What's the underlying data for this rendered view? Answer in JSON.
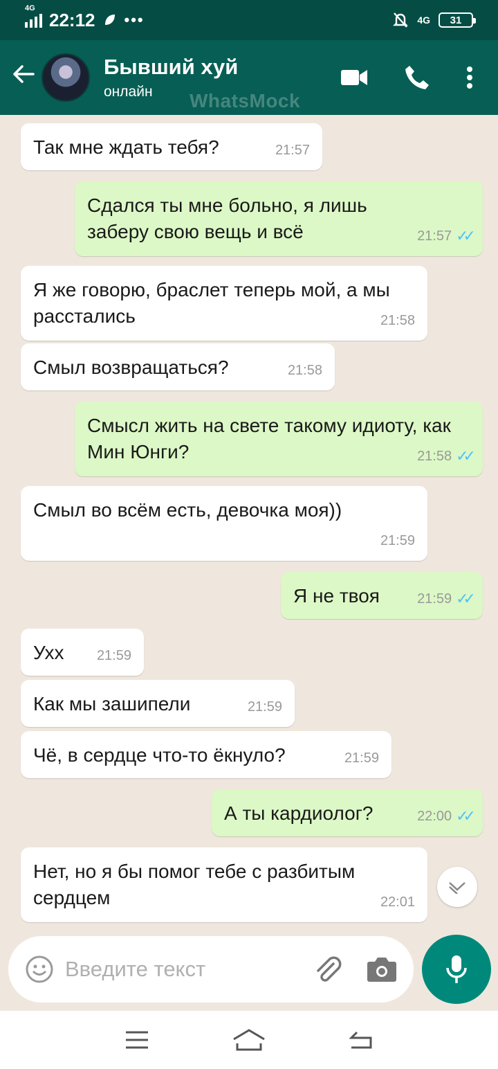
{
  "status_bar": {
    "network": "4G",
    "time": "22:12",
    "right_network": "4G",
    "battery": "31"
  },
  "header": {
    "contact_name": "Бывший хуй",
    "contact_status": "онлайн",
    "watermark": "WhatsMock"
  },
  "messages": [
    {
      "dir": "in",
      "text": "Так мне ждать тебя?",
      "time": "21:57"
    },
    {
      "dir": "out",
      "text": "Сдался ты мне больно, я лишь заберу свою вещь и всё",
      "time": "21:57"
    },
    {
      "dir": "in",
      "text": "Я же говорю, браслет теперь мой, а мы расстались",
      "time": "21:58"
    },
    {
      "dir": "in",
      "text": "Смыл возвращаться?",
      "time": "21:58"
    },
    {
      "dir": "out",
      "text": "Смысл жить на свете такому идиоту, как Мин Юнги?",
      "time": "21:58"
    },
    {
      "dir": "in",
      "text": "Смыл во всём есть, девочка моя))",
      "time": "21:59"
    },
    {
      "dir": "out",
      "text": "Я не твоя",
      "time": "21:59"
    },
    {
      "dir": "in",
      "text": "Ухх",
      "time": "21:59"
    },
    {
      "dir": "in",
      "text": "Как мы зашипели",
      "time": "21:59"
    },
    {
      "dir": "in",
      "text": "Чё, в сердце что-то ёкнуло?",
      "time": "21:59"
    },
    {
      "dir": "out",
      "text": "А ты кардиолог?",
      "time": "22:00"
    },
    {
      "dir": "in",
      "text": "Нет, но я бы помог тебе с разбитым сердцем",
      "time": "22:01"
    }
  ],
  "composer": {
    "placeholder": "Введите текст"
  },
  "colors": {
    "header": "#075e54",
    "status_bar": "#054d44",
    "outgoing_bubble": "#dcf8c6",
    "incoming_bubble": "#ffffff",
    "read_ticks": "#4fc3f7",
    "mic_button": "#00897b"
  },
  "icons": {
    "header": [
      "back-arrow-icon",
      "video-call-icon",
      "phone-icon",
      "more-vert-icon"
    ],
    "composer": [
      "emoji-icon",
      "attach-icon",
      "camera-icon",
      "mic-icon"
    ],
    "nav": [
      "menu-icon",
      "home-icon",
      "back-icon"
    ]
  }
}
